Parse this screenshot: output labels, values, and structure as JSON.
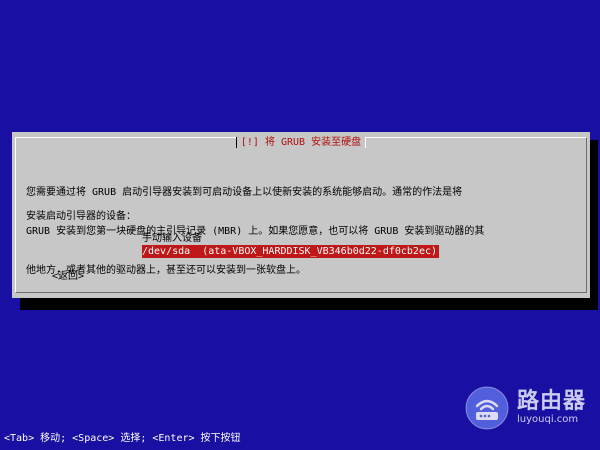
{
  "dialog": {
    "title": "[!] 将 GRUB 安装至硬盘",
    "description_lines": [
      "您需要通过将 GRUB 启动引导器安装到可启动设备上以使新安装的系统能够启动。通常的作法是将",
      "GRUB 安装到您第一块硬盘的主引导记录 (MBR) 上。如果您愿意，也可以将 GRUB 安装到驱动器的其",
      "他地方，或者其他的驱动器上，甚至还可以安装到一张软盘上。"
    ],
    "prompt": "安装启动引导器的设备：",
    "options": [
      {
        "label": "手动输入设备",
        "selected": false
      },
      {
        "label": "/dev/sda  (ata-VBOX_HARDDISK_VB346b0d22-df0cb2ec)",
        "selected": true
      }
    ],
    "back_label": "<返回>"
  },
  "status_bar": {
    "text": "<Tab> 移动; <Space> 选择; <Enter> 按下按钮"
  },
  "watermark": {
    "name": "路由器",
    "url": "luyouqi.com"
  },
  "colors": {
    "background": "#1a0fa3",
    "dialog": "#c7c7c7",
    "selection": "#c01818",
    "title": "#b01010"
  }
}
